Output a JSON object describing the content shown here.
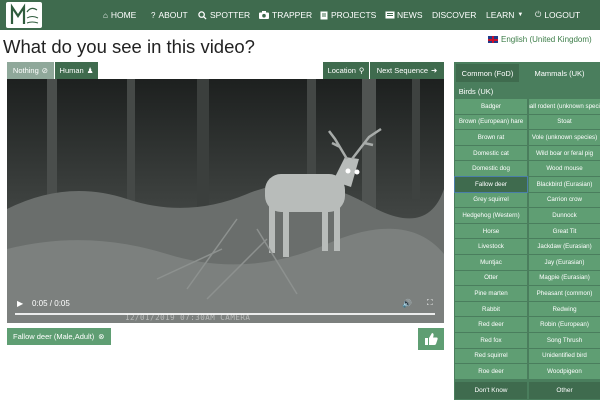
{
  "nav": {
    "home": "HOME",
    "about": "ABOUT",
    "spotter": "SPOTTER",
    "trapper": "TRAPPER",
    "projects": "PROJECTS",
    "news": "NEWS",
    "discover": "DISCOVER",
    "learn": "LEARN",
    "logout": "LOGOUT"
  },
  "language": "English (United Kingdom)",
  "page_title": "What do you see in this video?",
  "buttons": {
    "nothing": "Nothing",
    "human": "Human",
    "location": "Location",
    "next_sequence": "Next Sequence"
  },
  "video": {
    "time": "0:05 / 0:05",
    "progress": 1.0,
    "stamp": "12/01/2019  07:30AM  CAMERA"
  },
  "selected_tag": "Fallow deer (Male,Adult)",
  "tabs": {
    "common": "Common (FoD)",
    "mammals": "Mammals (UK)",
    "birds": "Birds (UK)"
  },
  "species_left": [
    "Badger",
    "Brown (European) hare",
    "Brown rat",
    "Domestic cat",
    "Domestic dog",
    "Fallow deer",
    "Grey squirrel",
    "Hedgehog (Western)",
    "Horse",
    "Livestock",
    "Muntjac",
    "Otter",
    "Pine marten",
    "Rabbit",
    "Red deer",
    "Red fox",
    "Red squirrel",
    "Roe deer"
  ],
  "species_right": [
    "Small rodent (unknown species)",
    "Stoat",
    "Vole (unknown species)",
    "Wild boar or feral pig",
    "Wood mouse",
    "Blackbird (Eurasian)",
    "Carrion crow",
    "Dunnock",
    "Great Tit",
    "Jackdaw (Eurasian)",
    "Jay (Eurasian)",
    "Magpie (Eurasian)",
    "Pheasant (common)",
    "Redwing",
    "Robin (European)",
    "Song Thrush",
    "Unidentified bird",
    "Woodpigeon"
  ],
  "selected_species": "Fallow deer",
  "footer": {
    "dont_know": "Don't Know",
    "other": "Other"
  },
  "colors": {
    "nav_bg": "#3f6b4e",
    "button": "#5f9e73",
    "button_dark": "#3f6b4e",
    "side_bg": "#4a7e5d"
  }
}
